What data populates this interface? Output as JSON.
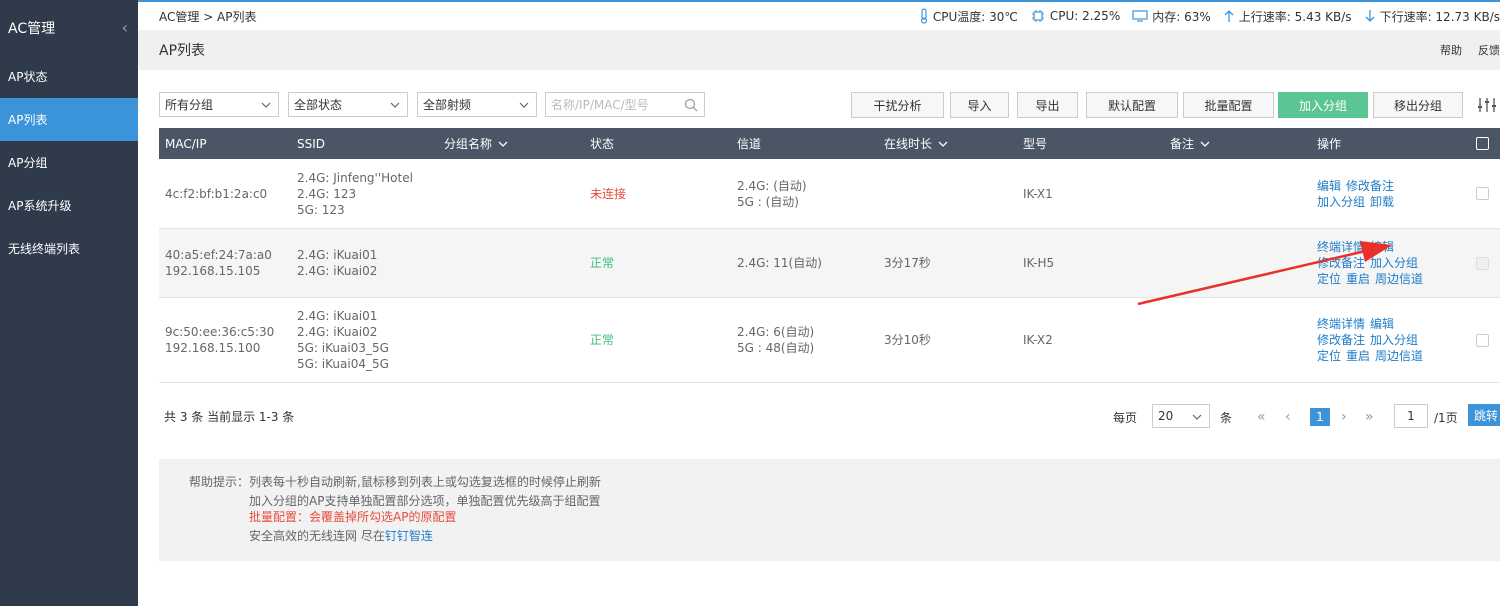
{
  "sidebar": {
    "title": "AC管理",
    "collapse_icon": "chevron-left-icon",
    "items": [
      {
        "label": "AP状态",
        "active": false
      },
      {
        "label": "AP列表",
        "active": true
      },
      {
        "label": "AP分组",
        "active": false
      },
      {
        "label": "AP系统升级",
        "active": false
      },
      {
        "label": "无线终端列表",
        "active": false
      }
    ]
  },
  "topbar": {
    "breadcrumb": "AC管理 > AP列表",
    "cpu_temp": "CPU温度: 30℃",
    "cpu": "CPU: 2.25%",
    "memory": "内存: 63%",
    "upload": "上行速率: 5.43 KB/s",
    "download": "下行速率: 12.73 KB/s"
  },
  "titlebar": {
    "title": "AP列表",
    "help": "帮助",
    "feedback": "反馈"
  },
  "toolbar": {
    "group_select": "所有分组",
    "status_select": "全部状态",
    "band_select": "全部射频",
    "search_placeholder": "名称/IP/MAC/型号",
    "buttons": {
      "interference": "干扰分析",
      "import": "导入",
      "export": "导出",
      "default_config": "默认配置",
      "batch_config": "批量配置",
      "join_group": "加入分组",
      "leave_group": "移出分组"
    }
  },
  "table": {
    "headers": {
      "mac_ip": "MAC/IP",
      "ssid": "SSID",
      "group": "分组名称",
      "status": "状态",
      "channel": "信道",
      "uptime": "在线时长",
      "model": "型号",
      "remark": "备注",
      "ops": "操作"
    },
    "rows": [
      {
        "mac_ip": [
          "4c:f2:bf:b1:2a:c0"
        ],
        "ssid": [
          "2.4G: Jinfeng''Hotel",
          "2.4G: 123",
          "5G: 123"
        ],
        "group": "",
        "status": "未连接",
        "status_type": "bad",
        "channel": [
          "2.4G: (自动)",
          "5G : (自动)"
        ],
        "uptime": "",
        "model": "IK-X1",
        "ops": [
          [
            "编辑",
            "修改备注"
          ],
          [
            "加入分组",
            "卸载"
          ]
        ]
      },
      {
        "mac_ip": [
          "40:a5:ef:24:7a:a0",
          "192.168.15.105"
        ],
        "ssid": [
          "2.4G: iKuai01",
          "2.4G: iKuai02"
        ],
        "group": "",
        "status": "正常",
        "status_type": "ok",
        "channel": [
          "2.4G: 11(自动)"
        ],
        "uptime": "3分17秒",
        "model": "IK-H5",
        "ops": [
          [
            "终端详情",
            "编辑"
          ],
          [
            "修改备注",
            "加入分组"
          ],
          [
            "定位",
            "重启",
            "周边信道"
          ]
        ]
      },
      {
        "mac_ip": [
          "9c:50:ee:36:c5:30",
          "192.168.15.100"
        ],
        "ssid": [
          "2.4G: iKuai01",
          "2.4G: iKuai02",
          "5G: iKuai03_5G",
          "5G: iKuai04_5G"
        ],
        "group": "",
        "status": "正常",
        "status_type": "ok",
        "channel": [
          "2.4G: 6(自动)",
          "5G : 48(自动)"
        ],
        "uptime": "3分10秒",
        "model": "IK-X2",
        "ops": [
          [
            "终端详情",
            "编辑"
          ],
          [
            "修改备注",
            "加入分组"
          ],
          [
            "定位",
            "重启",
            "周边信道"
          ]
        ]
      }
    ]
  },
  "footer": {
    "summary": "共 3 条 当前显示 1-3 条",
    "per_page_label": "每页",
    "per_page_value": "20",
    "per_page_unit": "条",
    "current_page": "1",
    "page_input": "1",
    "total_pages": "/1页",
    "jump": "跳转"
  },
  "help": {
    "prefix": "帮助提示：",
    "line1": "列表每十秒自动刷新,鼠标移到列表上或勾选复选框的时候停止刷新",
    "line2": "加入分组的AP支持单独配置部分选项，单独配置优先级高于组配置",
    "line3": "批量配置：会覆盖掉所勾选AP的原配置",
    "line4_text": "安全高效的无线连网 尽在",
    "line4_link": "钉钉智连"
  },
  "colors": {
    "sidebar_bg": "#2f3a4a",
    "accent": "#3b94d9",
    "header_bg": "#4a5566",
    "green": "#5cc594",
    "ok": "#3dbd7d",
    "bad": "#e74c3c",
    "link": "#1e7cc8",
    "annotation": "#e8312a"
  }
}
